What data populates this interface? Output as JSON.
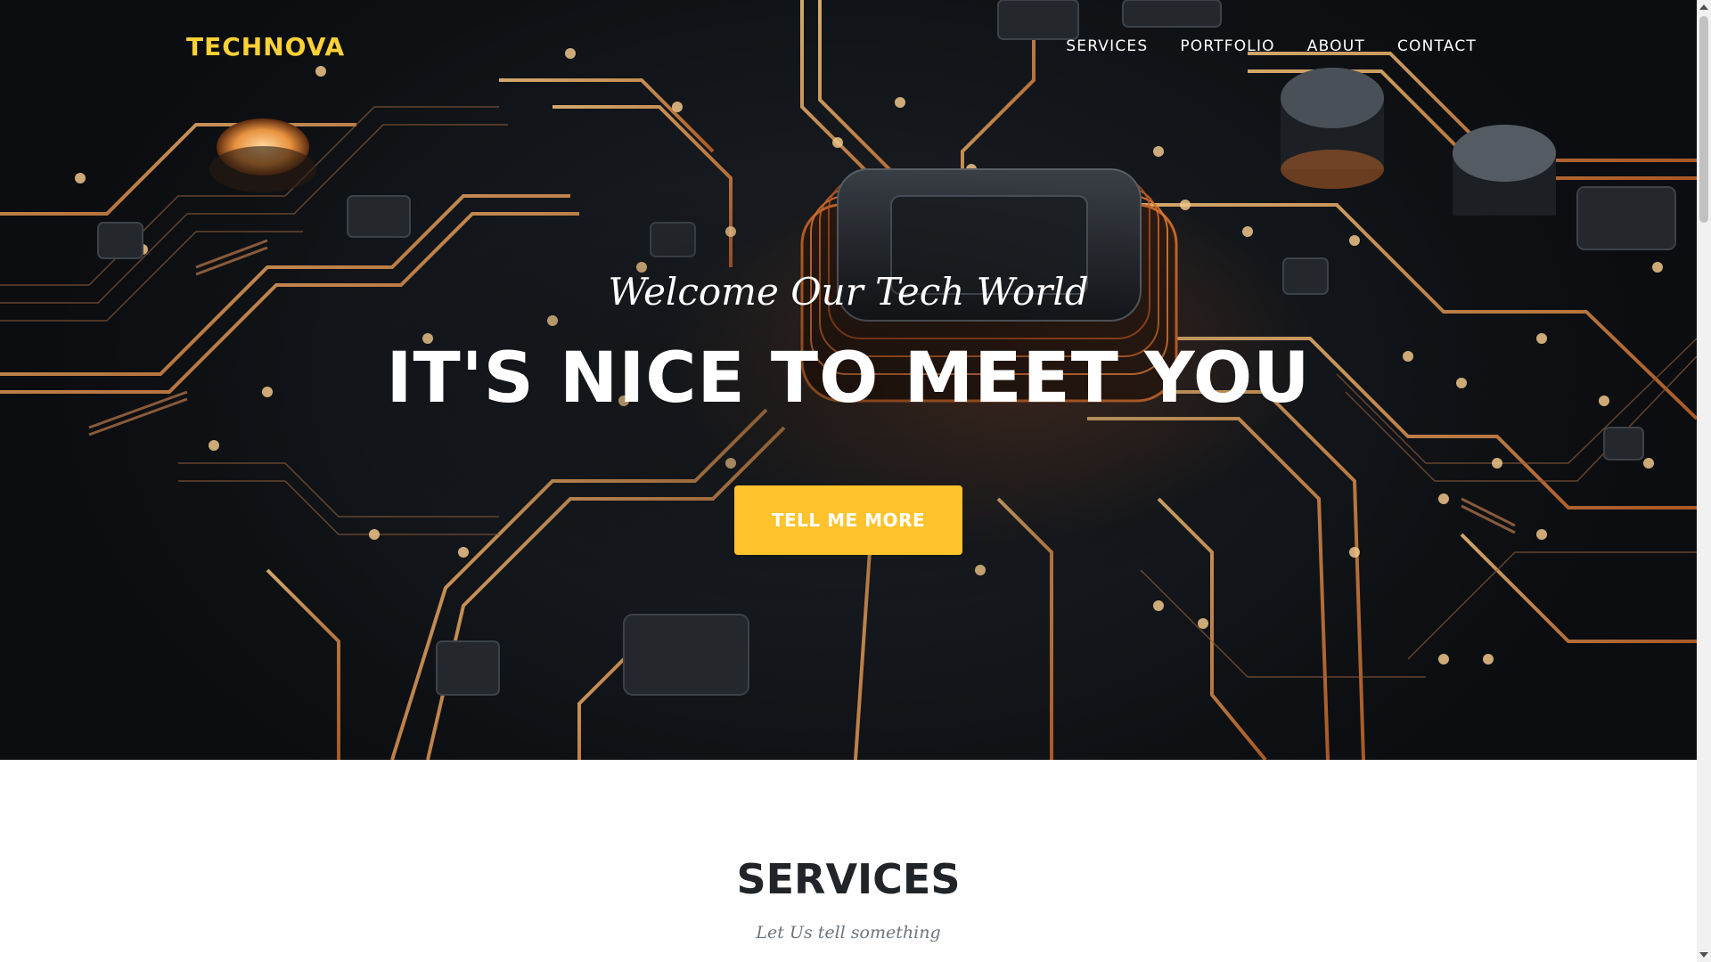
{
  "brand": {
    "name": "TECHNOVA",
    "color": "#fed136"
  },
  "nav": {
    "items": [
      {
        "label": "SERVICES"
      },
      {
        "label": "PORTFOLIO"
      },
      {
        "label": "ABOUT"
      },
      {
        "label": "CONTACT"
      }
    ]
  },
  "hero": {
    "welcome": "Welcome Our Tech World",
    "headline": "IT'S NICE TO MEET YOU",
    "cta_label": "TELL ME MORE",
    "cta_color": "#fec32c",
    "background": "circuit-board-image"
  },
  "services": {
    "title": "SERVICES",
    "subtitle": "Let Us tell something"
  }
}
